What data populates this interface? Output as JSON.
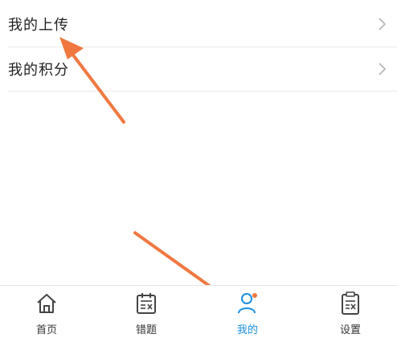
{
  "list": {
    "items": [
      {
        "label": "我的上传"
      },
      {
        "label": "我的积分"
      }
    ]
  },
  "tabbar": {
    "tabs": [
      {
        "label": "首页",
        "icon": "home-icon",
        "active": false
      },
      {
        "label": "错题",
        "icon": "calendar-x-icon",
        "active": false
      },
      {
        "label": "我的",
        "icon": "user-icon",
        "active": true
      },
      {
        "label": "设置",
        "icon": "clipboard-x-icon",
        "active": false
      }
    ]
  },
  "colors": {
    "accent": "#1a8fe0",
    "annotation_arrow": "#f07840",
    "text": "#222222",
    "divider": "#e8e8e8"
  }
}
